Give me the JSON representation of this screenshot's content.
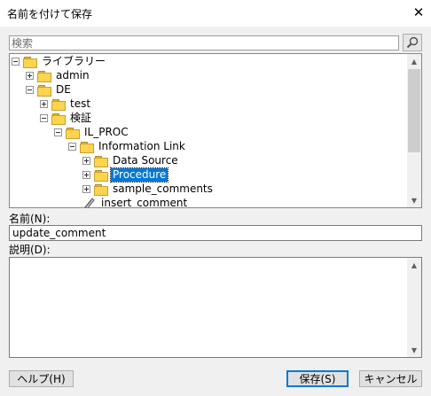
{
  "window": {
    "title": "名前を付けて保存",
    "close_glyph": "✕"
  },
  "search": {
    "placeholder": "検索",
    "value": ""
  },
  "tree": {
    "nodes": [
      {
        "label": "ライブラリー",
        "expander": "minus",
        "icon": "folder-icon",
        "selected": false
      },
      {
        "label": "admin",
        "expander": "plus",
        "icon": "folder-icon",
        "selected": false
      },
      {
        "label": "DE",
        "expander": "minus",
        "icon": "folder-icon",
        "selected": false
      },
      {
        "label": "test",
        "expander": "plus",
        "icon": "folder-icon",
        "selected": false
      },
      {
        "label": "検証",
        "expander": "minus",
        "icon": "folder-icon",
        "selected": false
      },
      {
        "label": "IL_PROC",
        "expander": "minus",
        "icon": "folder-icon",
        "selected": false
      },
      {
        "label": "Information Link",
        "expander": "minus",
        "icon": "folder-icon",
        "selected": false
      },
      {
        "label": "Data Source",
        "expander": "plus",
        "icon": "folder-icon",
        "selected": false
      },
      {
        "label": "Procedure",
        "expander": "plus",
        "icon": "folder-icon",
        "selected": true
      },
      {
        "label": "sample_comments",
        "expander": "plus",
        "icon": "folder-icon",
        "selected": false
      },
      {
        "label": "insert_comment",
        "expander": "none",
        "icon": "procedure-icon",
        "selected": false
      }
    ]
  },
  "name_field": {
    "label": "名前(N):",
    "value": "update_comment"
  },
  "description_field": {
    "label": "説明(D):",
    "value": ""
  },
  "buttons": {
    "help": "ヘルプ(H)",
    "save": "保存(S)",
    "cancel": "キャンセル"
  },
  "colors": {
    "selection": "#0078d7",
    "folder": "#fcd44e",
    "dialog_bg": "#f0f0f0"
  }
}
